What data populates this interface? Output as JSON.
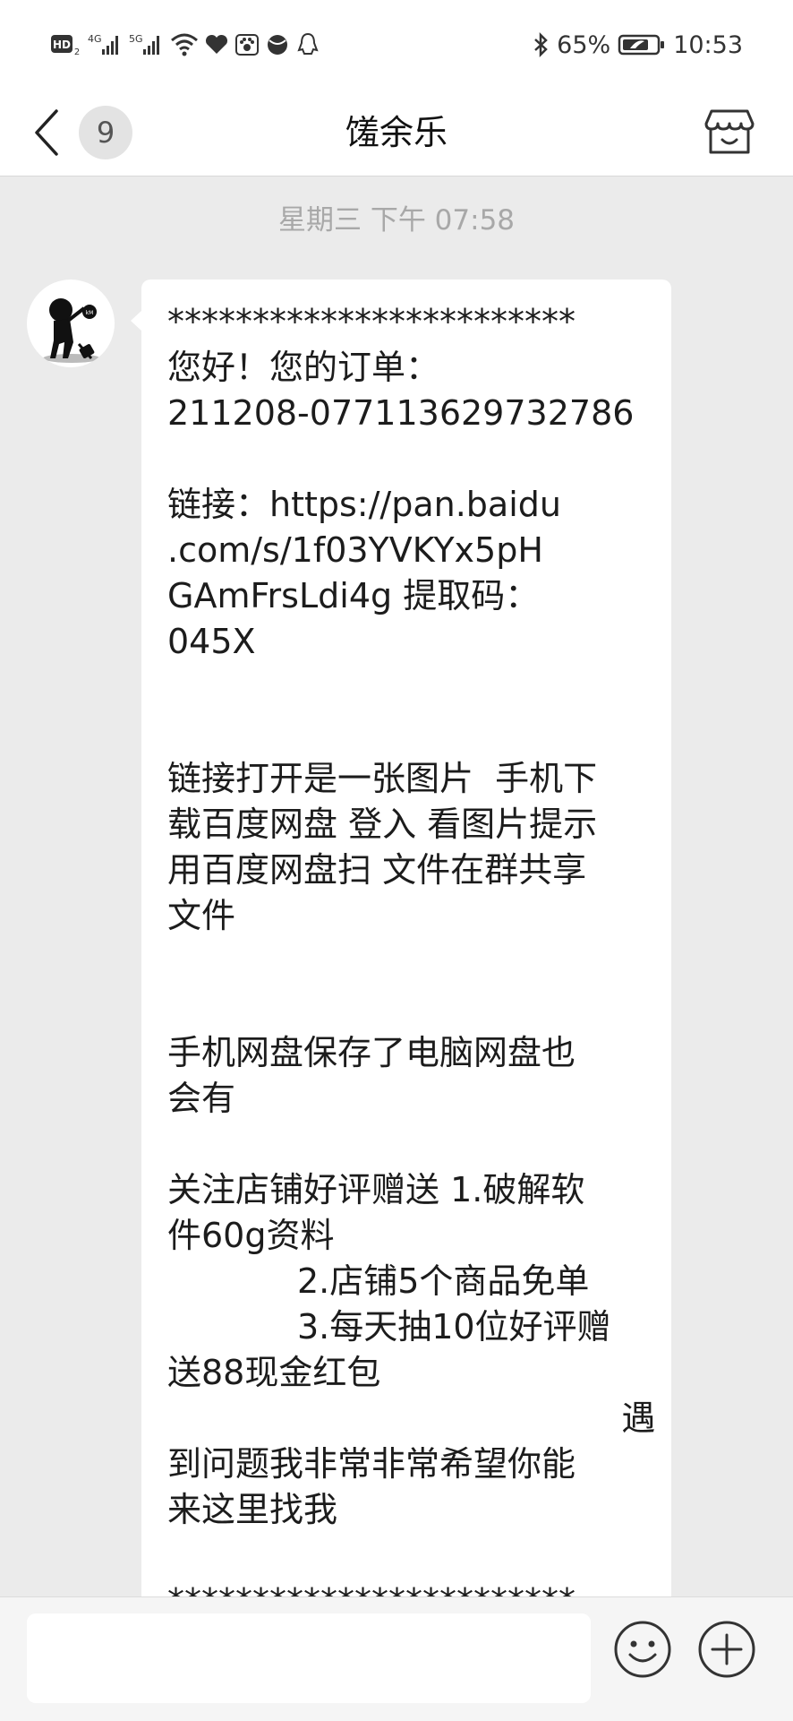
{
  "status_bar": {
    "network_hd": "HD",
    "network_4g": "4G",
    "network_5g": "5G",
    "battery_percent": "65%",
    "time": "10:53"
  },
  "header": {
    "back_badge": "9",
    "title": "馐余乐"
  },
  "chat": {
    "timestamp": "星期三 下午 07:58",
    "message": "************************\n您好！您的订单：\n211208-077113629732786\n\n链接：https://pan.baidu\n.com/s/1f03YVKYx5pH\nGAmFrsLdi4g 提取码：\n045X\n\n\n链接打开是一张图片  手机下\n载百度网盘 登入 看图片提示\n用百度网盘扫 文件在群共享\n文件\n\n\n手机网盘保存了电脑网盘也\n会有\n\n关注店铺好评赠送 1.破解软\n件60g资料\n            2.店铺5个商品免单\n            3.每天抽10位好评赠\n送88现金红包\n                                          遇\n到问题我非常非常希望你能\n来这里找我\n\n************************"
  },
  "input": {
    "placeholder": ""
  },
  "icons": {
    "back": "chevron-left-icon",
    "shop": "shop-icon",
    "emoji": "emoji-icon",
    "plus": "plus-icon"
  }
}
